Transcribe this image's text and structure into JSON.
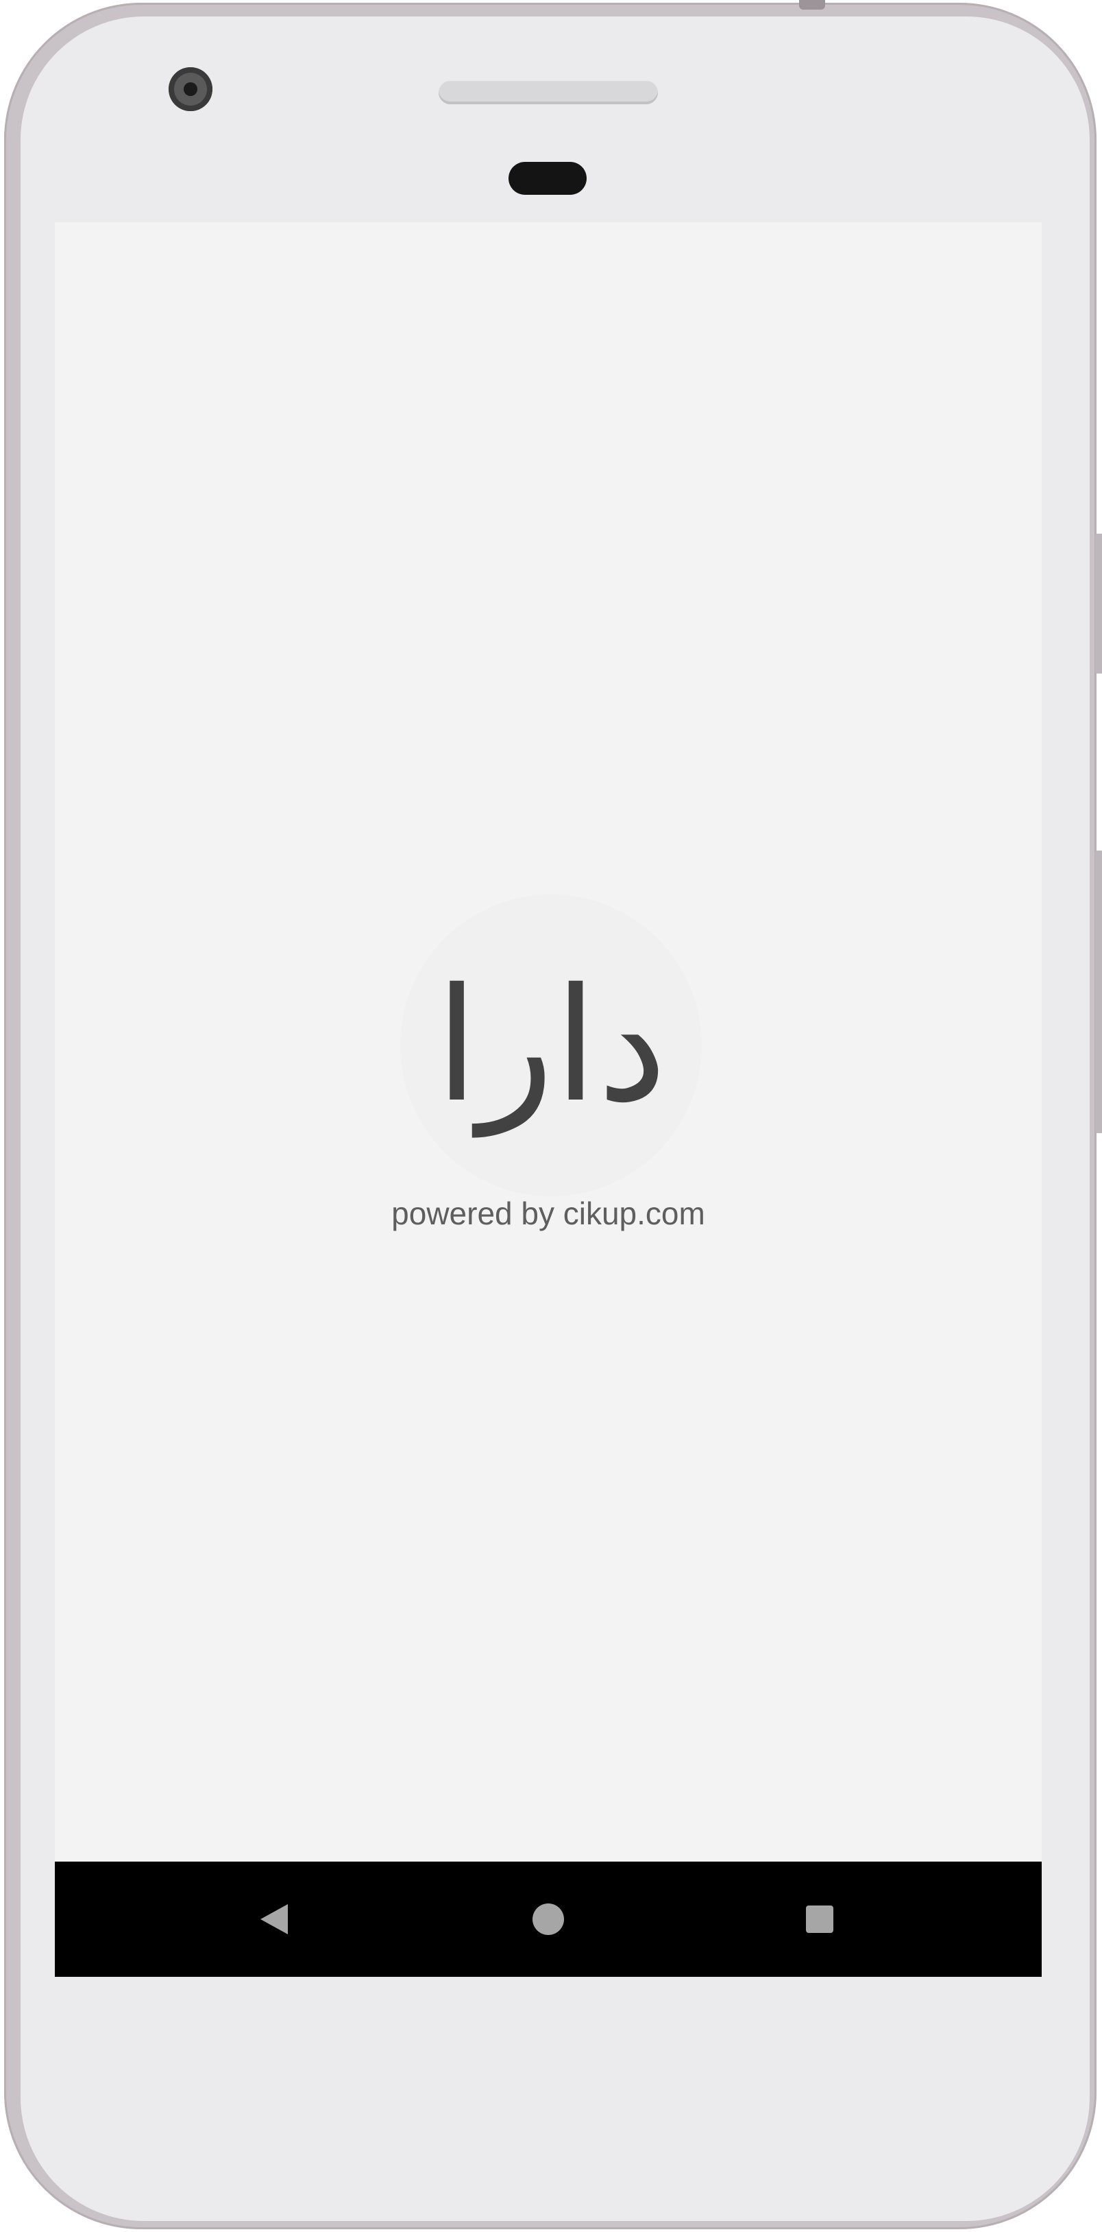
{
  "splash": {
    "logo_text": "دارا",
    "powered_by": "powered by cikup.com"
  },
  "navigation": {
    "back": "back-icon",
    "home": "home-icon",
    "recents": "recent-apps-icon"
  },
  "colors": {
    "screen_background": "#f3f3f4",
    "logo_color": "#424242",
    "caption_color": "#5e5e5e",
    "nav_bar": "#000000",
    "nav_icons": "#a6a6a6"
  }
}
